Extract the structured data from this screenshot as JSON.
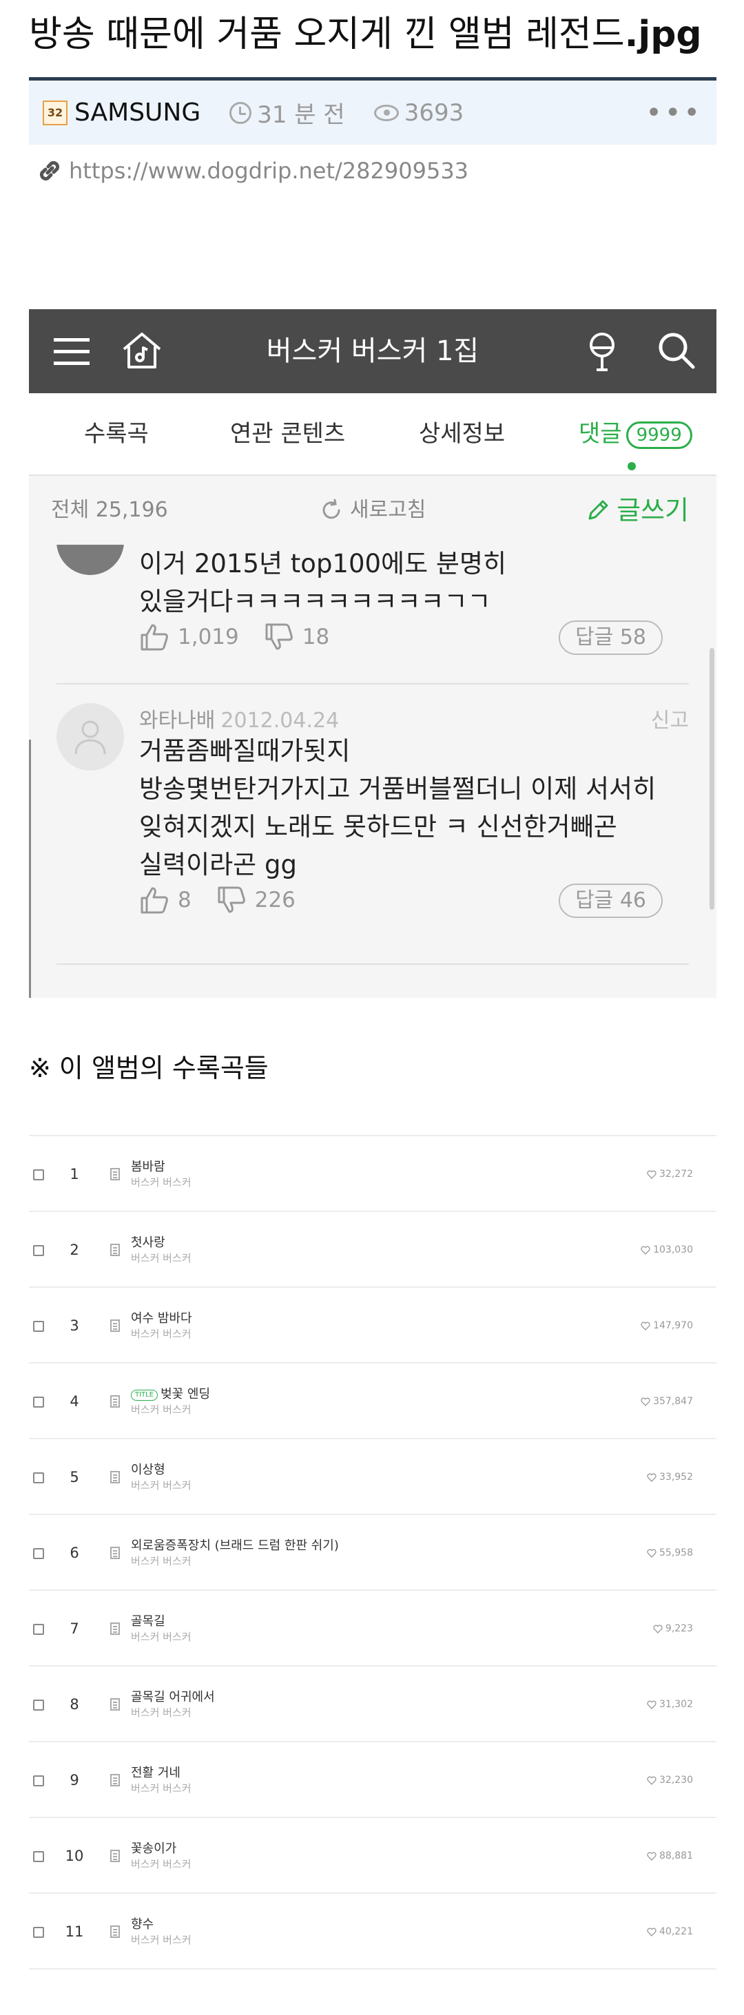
{
  "post": {
    "title_main": "방송 때문에 거품 오지게 낀 앨범 레전드",
    "title_ext": ".jpg",
    "author_badge": "32",
    "author": "SAMSUNG",
    "time": "31 분 전",
    "views": "3693",
    "more": "•••",
    "url": "https://www.dogdrip.net/282909533"
  },
  "app": {
    "title": "버스커 버스커 1집",
    "tabs": [
      {
        "label": "수록곡"
      },
      {
        "label": "연관 콘텐츠"
      },
      {
        "label": "상세정보"
      },
      {
        "label": "댓글",
        "badge": "9999"
      }
    ],
    "toolbar": {
      "total": "전체 25,196",
      "refresh": "새로고침",
      "write": "글쓰기"
    },
    "comments": [
      {
        "user": "",
        "date": "",
        "lines": [
          "이거 2015년 top100에도 분명히",
          "있을거다ㅋㅋㅋㅋㅋㅋㅋㅋㅋㄱㄱ"
        ],
        "likes": "1,019",
        "dislikes": "18",
        "replies": "답글 58"
      },
      {
        "user": "와타나배",
        "date": "2012.04.24",
        "report": "신고",
        "lines": [
          "거품좀빠질때가됫지",
          "방송몇번탄거가지고 거품버블쩔더니 이제 서서히",
          "잊혀지겠지 노래도 못하드만 ㅋ 신선한거빼곤",
          "실력이라곤 gg"
        ],
        "likes": "8",
        "dislikes": "226",
        "replies": "답글 46"
      }
    ]
  },
  "tracklist": {
    "heading": "※ 이 앨범의 수록곡들",
    "title_badge": "TITLE",
    "tracks": [
      {
        "num": "1",
        "song": "봄바람",
        "artist": "버스커 버스커",
        "likes": "32,272"
      },
      {
        "num": "2",
        "song": "첫사랑",
        "artist": "버스커 버스커",
        "likes": "103,030"
      },
      {
        "num": "3",
        "song": "여수 밤바다",
        "artist": "버스커 버스커",
        "likes": "147,970"
      },
      {
        "num": "4",
        "song": "벚꽃 엔딩",
        "artist": "버스커 버스커",
        "likes": "357,847",
        "title_track": true
      },
      {
        "num": "5",
        "song": "이상형",
        "artist": "버스커 버스커",
        "likes": "33,952"
      },
      {
        "num": "6",
        "song": "외로움증폭장치 (브래드 드럼 한판 쉬기)",
        "artist": "버스커 버스커",
        "likes": "55,958"
      },
      {
        "num": "7",
        "song": "골목길",
        "artist": "버스커 버스커",
        "likes": "9,223"
      },
      {
        "num": "8",
        "song": "골목길 어귀에서",
        "artist": "버스커 버스커",
        "likes": "31,302"
      },
      {
        "num": "9",
        "song": "전활 거네",
        "artist": "버스커 버스커",
        "likes": "32,230"
      },
      {
        "num": "10",
        "song": "꽃송이가",
        "artist": "버스커 버스커",
        "likes": "88,881"
      },
      {
        "num": "11",
        "song": "향수",
        "artist": "버스커 버스커",
        "likes": "40,221"
      }
    ]
  }
}
